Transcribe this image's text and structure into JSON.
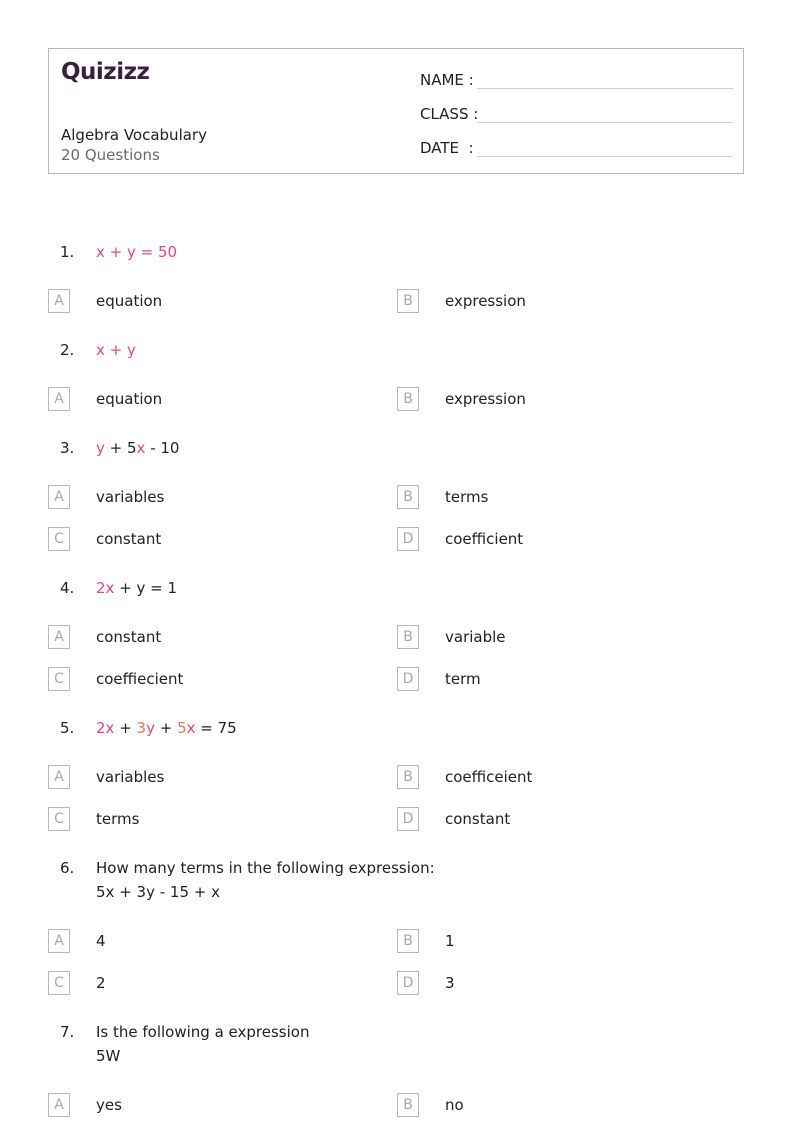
{
  "header": {
    "logo": "Quizizz",
    "title": "Algebra Vocabulary",
    "subtitle": "20 Questions",
    "fields": [
      {
        "label": "NAME :"
      },
      {
        "label": "CLASS :"
      },
      {
        "label": "DATE  :"
      }
    ]
  },
  "colors": {
    "accent_pink": "#e5487a",
    "accent_orange": "#f0735a",
    "logo": "#3b1f3f"
  },
  "questions": [
    {
      "number": "1.",
      "parts": [
        {
          "text": "x + y = 50",
          "color": "pink"
        }
      ],
      "options": [
        {
          "letter": "A",
          "text": "equation"
        },
        {
          "letter": "B",
          "text": "expression"
        }
      ]
    },
    {
      "number": "2.",
      "parts": [
        {
          "text": "x + y",
          "color": "pink"
        }
      ],
      "options": [
        {
          "letter": "A",
          "text": "equation"
        },
        {
          "letter": "B",
          "text": "expression"
        }
      ]
    },
    {
      "number": "3.",
      "parts": [
        {
          "text": "y",
          "color": "pink"
        },
        {
          "text": " + 5",
          "color": ""
        },
        {
          "text": "x",
          "color": "pink"
        },
        {
          "text": " - 10",
          "color": ""
        }
      ],
      "options": [
        {
          "letter": "A",
          "text": "variables"
        },
        {
          "letter": "B",
          "text": "terms"
        },
        {
          "letter": "C",
          "text": "constant"
        },
        {
          "letter": "D",
          "text": "coefficient"
        }
      ]
    },
    {
      "number": "4.",
      "parts": [
        {
          "text": "2x",
          "color": "pink"
        },
        {
          "text": " + y = 1",
          "color": ""
        }
      ],
      "options": [
        {
          "letter": "A",
          "text": "constant"
        },
        {
          "letter": "B",
          "text": "variable"
        },
        {
          "letter": "C",
          "text": "coeffiecient"
        },
        {
          "letter": "D",
          "text": "term"
        }
      ]
    },
    {
      "number": "5.",
      "parts": [
        {
          "text": "2x",
          "color": "pink"
        },
        {
          "text": " + ",
          "color": ""
        },
        {
          "text": "3",
          "color": "orange"
        },
        {
          "text": "y",
          "color": "pink"
        },
        {
          "text": " + ",
          "color": ""
        },
        {
          "text": "5",
          "color": "orange"
        },
        {
          "text": "x",
          "color": "pink"
        },
        {
          "text": " = 75",
          "color": ""
        }
      ],
      "options": [
        {
          "letter": "A",
          "text": "variables"
        },
        {
          "letter": "B",
          "text": "coefficeient"
        },
        {
          "letter": "C",
          "text": "terms"
        },
        {
          "letter": "D",
          "text": "constant"
        }
      ]
    },
    {
      "number": "6.",
      "lines": [
        "How many terms in the following expression:",
        "5x + 3y - 15 + x"
      ],
      "options": [
        {
          "letter": "A",
          "text": "4"
        },
        {
          "letter": "B",
          "text": "1"
        },
        {
          "letter": "C",
          "text": "2"
        },
        {
          "letter": "D",
          "text": "3"
        }
      ]
    },
    {
      "number": "7.",
      "lines": [
        "Is the following a expression",
        "5W"
      ],
      "options": [
        {
          "letter": "A",
          "text": "yes"
        },
        {
          "letter": "B",
          "text": "no"
        }
      ]
    }
  ]
}
